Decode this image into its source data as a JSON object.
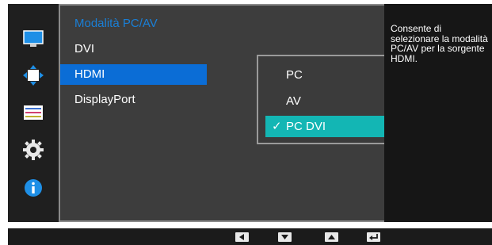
{
  "sidebar": {
    "icons": [
      {
        "name": "monitor-icon"
      },
      {
        "name": "resize-icon"
      },
      {
        "name": "color-adjust-icon"
      },
      {
        "name": "settings-gear-icon"
      },
      {
        "name": "info-icon"
      }
    ]
  },
  "menu": {
    "title": "Modalità PC/AV",
    "items": [
      {
        "label": "DVI"
      },
      {
        "label": "HDMI"
      },
      {
        "label": "DisplayPort"
      }
    ],
    "selected_index": 1
  },
  "submenu": {
    "options": [
      {
        "label": "PC"
      },
      {
        "label": "AV"
      },
      {
        "label": "PC DVI"
      }
    ],
    "selected_index": 2,
    "check_glyph": "✓"
  },
  "description": {
    "text": "Consente di selezionare la modalità PC/AV per la sorgente HDMI."
  },
  "nav_buttons": [
    {
      "name": "left-arrow-button-icon"
    },
    {
      "name": "down-arrow-button-icon"
    },
    {
      "name": "up-arrow-button-icon"
    },
    {
      "name": "enter-button-icon"
    }
  ],
  "colors": {
    "accent_title": "#1a7fd6",
    "menu_selected": "#0b6dd6",
    "submenu_selected": "#13b6b4"
  }
}
